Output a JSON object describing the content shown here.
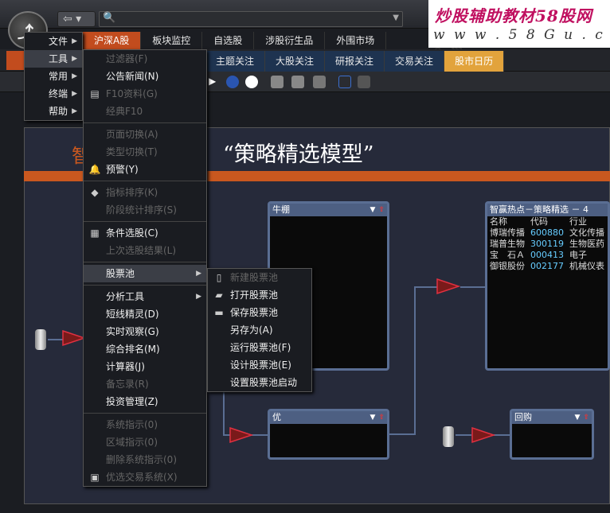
{
  "app": {
    "logo_text": "⤴"
  },
  "watermark": {
    "line1": "炒股辅助教材58股网",
    "line2": "w w w . 5 8 G u . c o m"
  },
  "search": {
    "value": "",
    "icon": "search-icon"
  },
  "main_tabs": [
    "沪深A股",
    "板块监控",
    "自选股",
    "涉股衍生品",
    "外围市场"
  ],
  "sub_tabs": [
    "主题关注",
    "大股关注",
    "研报关注",
    "交易关注",
    "股市日历"
  ],
  "canvas": {
    "title": "“策略精选模型”",
    "left_title": "智"
  },
  "nodes": {
    "bull": {
      "title": "牛棚"
    },
    "you": {
      "title": "优"
    },
    "huigou": {
      "title": "回购"
    },
    "hot": {
      "title": "智赢热点－策略精选 － 4",
      "columns": [
        "名称",
        "代码",
        "行业"
      ],
      "rows": [
        [
          "博瑞传播",
          "600880",
          "文化传播"
        ],
        [
          "瑞普生物",
          "300119",
          "生物医药"
        ],
        [
          "宝　石Ａ",
          "000413",
          "电子"
        ],
        [
          "御银股份",
          "002177",
          "机械仪表"
        ]
      ]
    }
  },
  "menu_main": [
    "文件",
    "工具",
    "常用",
    "终端",
    "帮助"
  ],
  "menu_tools": [
    {
      "label": "过滤器(F)",
      "dis": true
    },
    {
      "label": "公告新闻(N)",
      "dis": false
    },
    {
      "label": "F10资料(G)",
      "dis": true
    },
    {
      "label": "经典F10",
      "dis": true
    },
    {
      "sep": true
    },
    {
      "label": "页面切换(A)",
      "dis": true
    },
    {
      "label": "类型切换(T)",
      "dis": true
    },
    {
      "label": "预警(Y)",
      "dis": false
    },
    {
      "sep": true
    },
    {
      "label": "指标排序(K)",
      "dis": true
    },
    {
      "label": "阶段统计排序(S)",
      "dis": true
    },
    {
      "sep": true
    },
    {
      "label": "条件选股(C)",
      "dis": false
    },
    {
      "label": "上次选股结果(L)",
      "dis": true
    },
    {
      "sep": true
    },
    {
      "label": "股票池",
      "dis": false,
      "sub": true,
      "sel": true
    },
    {
      "sep": true
    },
    {
      "label": "分析工具",
      "dis": false,
      "sub": true
    },
    {
      "label": "短线精灵(D)",
      "dis": false
    },
    {
      "label": "实时观察(G)",
      "dis": false
    },
    {
      "label": "综合排名(M)",
      "dis": false
    },
    {
      "label": "计算器(J)",
      "dis": false
    },
    {
      "label": "备忘录(R)",
      "dis": true
    },
    {
      "label": "投资管理(Z)",
      "dis": false
    },
    {
      "sep": true
    },
    {
      "label": "系统指示(0)",
      "dis": true
    },
    {
      "label": "区域指示(0)",
      "dis": true
    },
    {
      "label": "删除系统指示(0)",
      "dis": true
    },
    {
      "label": "优选交易系统(X)",
      "dis": true
    }
  ],
  "menu_pool": [
    {
      "label": "新建股票池",
      "dis": true
    },
    {
      "label": "打开股票池",
      "dis": false
    },
    {
      "label": "保存股票池",
      "dis": false
    },
    {
      "label": "另存为(A)",
      "dis": false
    },
    {
      "label": "运行股票池(F)",
      "dis": false
    },
    {
      "label": "设计股票池(E)",
      "dis": false
    },
    {
      "label": "设置股票池启动",
      "dis": false
    }
  ]
}
